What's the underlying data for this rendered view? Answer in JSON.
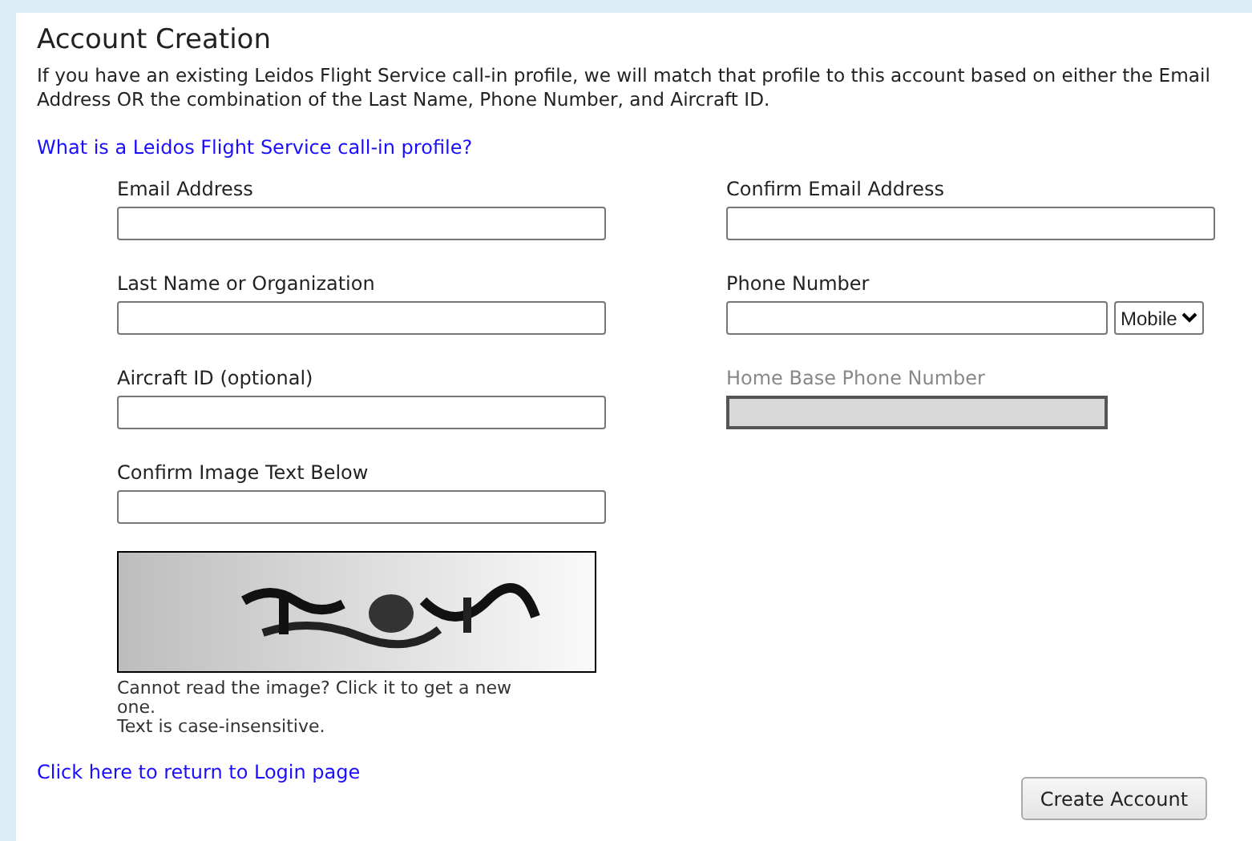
{
  "title": "Account Creation",
  "intro": "If you have an existing Leidos Flight Service call-in profile, we will match that profile to this account based on either the Email Address OR the combination of the Last Name, Phone Number, and Aircraft ID.",
  "help_link": "What is a Leidos Flight Service call-in profile?",
  "fields": [
    {
      "label": "Email Address",
      "kind": "text",
      "disabled": false
    },
    {
      "label": "Confirm Email Address",
      "kind": "text",
      "disabled": false
    },
    {
      "label": "Last Name or Organization",
      "kind": "text",
      "disabled": false
    },
    {
      "label": "Phone Number",
      "kind": "phone",
      "disabled": false,
      "phone_type": "Mobile"
    },
    {
      "label": "Aircraft ID (optional)",
      "kind": "text",
      "disabled": false
    },
    {
      "label": "Home Base Phone Number",
      "kind": "text",
      "disabled": true
    },
    {
      "label": "Confirm Image Text Below",
      "kind": "text",
      "disabled": false
    }
  ],
  "captcha_notes": [
    "Cannot read the image? Click it to get a new one.",
    "Text is case-insensitive."
  ],
  "login_link": "Click here to return to Login page",
  "submit_button": "Create Account"
}
